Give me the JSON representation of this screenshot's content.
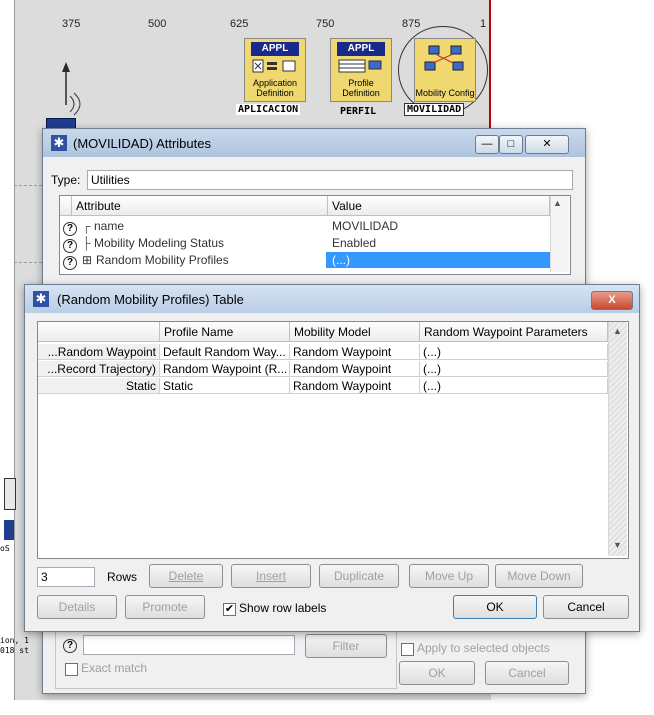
{
  "canvas": {
    "ruler_ticks": [
      "375",
      "500",
      "625",
      "750",
      "875",
      "1"
    ],
    "nodes": [
      {
        "header": "APPL",
        "label": "Application Definition",
        "caption": "APLICACION"
      },
      {
        "header": "APPL",
        "label": "Profile Definition",
        "caption": "PERFIL"
      },
      {
        "header": "",
        "label": "Mobility Config",
        "caption": "MOVILIDAD"
      }
    ],
    "left_edge_text": [
      "ion, 1",
      "018 st",
      "oS"
    ]
  },
  "attributes_window": {
    "title": "(MOVILIDAD) Attributes",
    "type_label": "Type:",
    "type_value": "Utilities",
    "columns": {
      "attribute": "Attribute",
      "value": "Value"
    },
    "rows": [
      {
        "attribute": "name",
        "value": "MOVILIDAD"
      },
      {
        "attribute": "Mobility Modeling Status",
        "value": "Enabled"
      },
      {
        "attribute": "Random Mobility Profiles",
        "value": "(...)"
      }
    ],
    "filter_button": "Filter",
    "exact_match_label": "Exact match",
    "apply_selected_label": "Apply to selected objects",
    "ok_button": "OK",
    "cancel_button": "Cancel",
    "min_glyph": "—",
    "max_glyph": "□",
    "close_glyph": "✕"
  },
  "table_window": {
    "title": "(Random Mobility Profiles) Table",
    "columns": [
      "Profile Name",
      "Mobility Model",
      "Random Waypoint Parameters"
    ],
    "rows": [
      {
        "label": "...Random Waypoint",
        "cells": [
          "Default Random Way...",
          "Random Waypoint",
          "(...)"
        ]
      },
      {
        "label": "...Record Trajectory)",
        "cells": [
          "Random Waypoint (R...",
          "Random Waypoint",
          "(...)"
        ]
      },
      {
        "label": "Static",
        "cells": [
          "Static",
          "Random Waypoint",
          "(...)"
        ]
      }
    ],
    "rows_count": "3",
    "rows_label": "Rows",
    "buttons": {
      "delete": "Delete",
      "insert": "Insert",
      "duplicate": "Duplicate",
      "move_up": "Move Up",
      "move_down": "Move Down",
      "details": "Details",
      "promote": "Promote",
      "ok": "OK",
      "cancel": "Cancel"
    },
    "show_row_labels": "Show row labels",
    "show_row_labels_checked": true,
    "close_glyph": "X"
  }
}
